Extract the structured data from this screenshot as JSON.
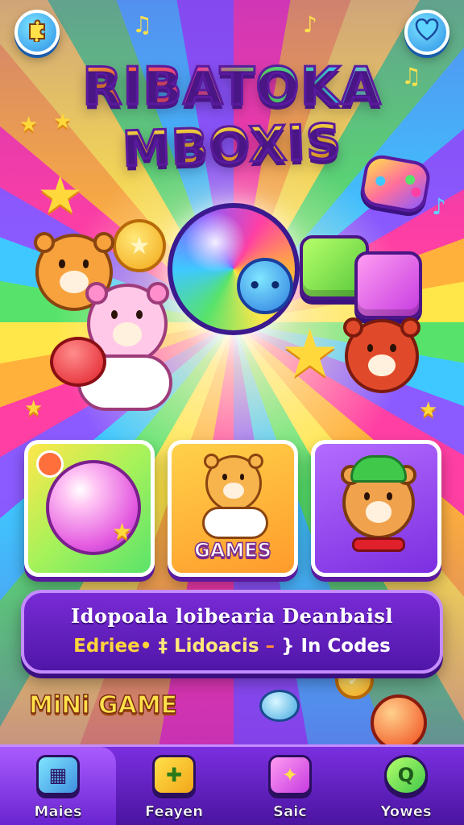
{
  "header": {
    "title_line_1": "RIBATOKA",
    "title_line_2": "MBOXIS",
    "left_button_icon": "puzzle-music-icon",
    "right_button_icon": "heart-icon"
  },
  "cards": [
    {
      "label": "",
      "icon": "bubble-orb-icon"
    },
    {
      "label": "GAMES",
      "icon": "bear-character"
    },
    {
      "label": "",
      "icon": "bear-with-hat-character"
    }
  ],
  "info_panel": {
    "line_1": "Idopoala loibearia Deanbaisl",
    "line_2": {
      "part_1": "Edriee•",
      "part_2": "‡ Lidoacis",
      "part_3": "–",
      "part_4": "} In Codes"
    }
  },
  "mini_game_title": "MiNi GAME",
  "nav": {
    "items": [
      {
        "label": "Maies",
        "icon": "cards-icon",
        "active": true
      },
      {
        "label": "Feayen",
        "icon": "gift-box-icon",
        "active": false
      },
      {
        "label": "Saic",
        "icon": "gift-box-icon",
        "active": false
      },
      {
        "label": "Yowes",
        "icon": "search-icon",
        "active": false
      }
    ]
  },
  "colors": {
    "primary_purple": "#7a2bd6",
    "accent_yellow": "#ffe14a",
    "accent_pink": "#ff3fa4",
    "accent_blue": "#3fc8ff",
    "accent_green": "#57e36b"
  }
}
